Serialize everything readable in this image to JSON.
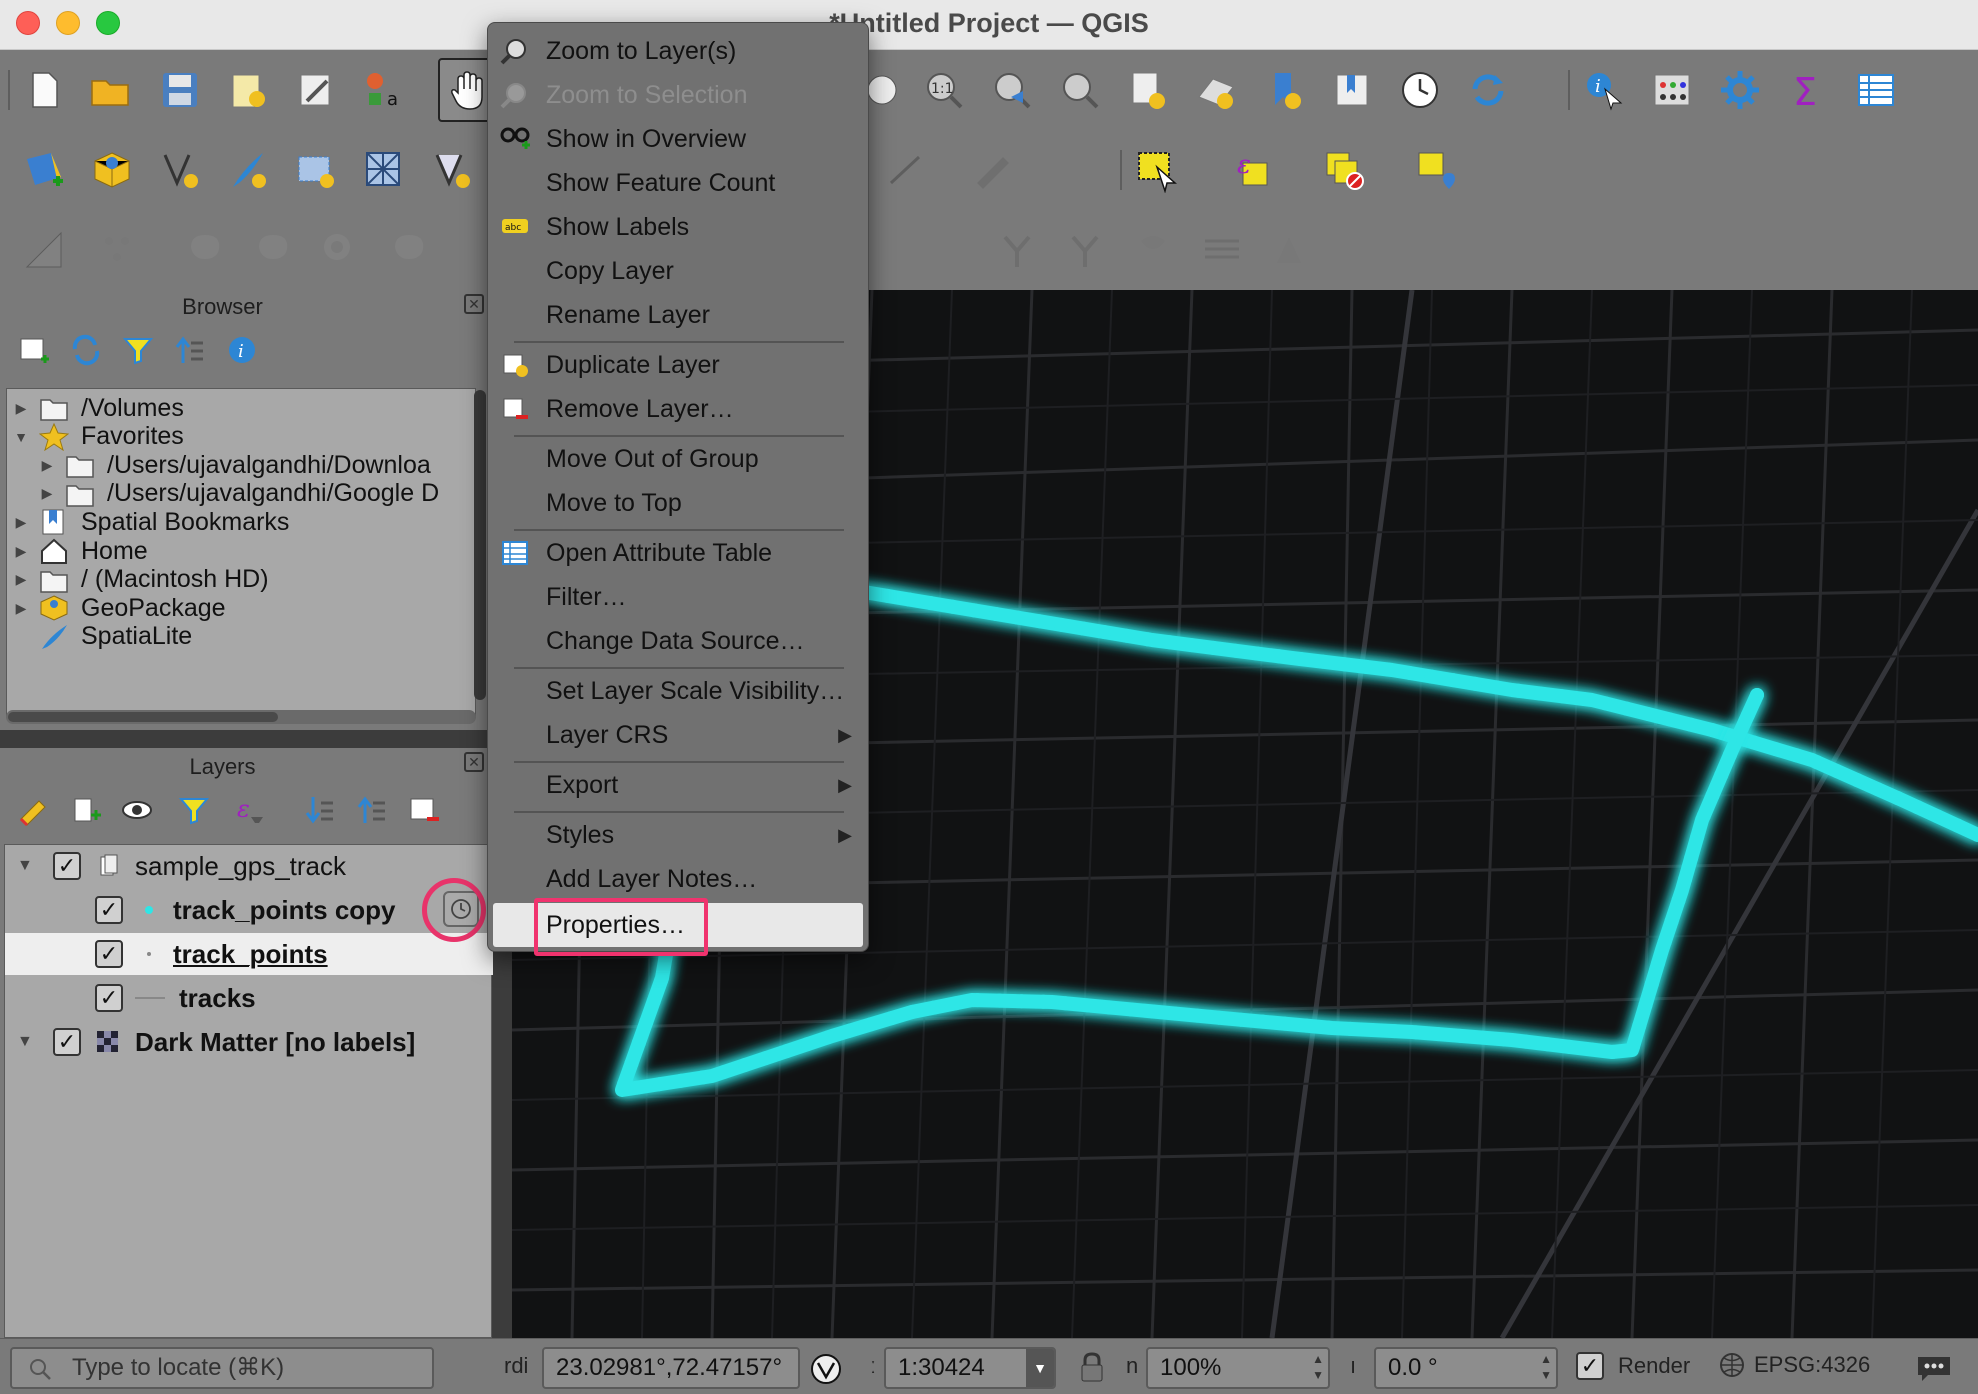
{
  "window": {
    "title": "*Untitled Project — QGIS"
  },
  "browser": {
    "title": "Browser",
    "items": [
      {
        "label": "/Volumes",
        "indent": 0,
        "arrow": "▶"
      },
      {
        "label": "Favorites",
        "indent": 0,
        "arrow": "▼"
      },
      {
        "label": "/Users/ujavalgandhi/Downloa",
        "indent": 1,
        "arrow": "▶"
      },
      {
        "label": "/Users/ujavalgandhi/Google D",
        "indent": 1,
        "arrow": "▶"
      },
      {
        "label": "Spatial Bookmarks",
        "indent": 0,
        "arrow": "▶"
      },
      {
        "label": "Home",
        "indent": 0,
        "arrow": "▶"
      },
      {
        "label": "/ (Macintosh HD)",
        "indent": 0,
        "arrow": "▶"
      },
      {
        "label": "GeoPackage",
        "indent": 0,
        "arrow": "▶"
      },
      {
        "label": "SpatiaLite",
        "indent": 0,
        "arrow": ""
      }
    ]
  },
  "layers": {
    "title": "Layers",
    "items": [
      {
        "label": "sample_gps_track",
        "checked": "✓",
        "arrow": "▼"
      },
      {
        "label": "track_points copy",
        "checked": "✓"
      },
      {
        "label": "track_points",
        "checked": "✓"
      },
      {
        "label": "tracks",
        "checked": "✓"
      },
      {
        "label": "Dark Matter [no labels]",
        "checked": "✓",
        "arrow": "▼"
      }
    ]
  },
  "context_menu": {
    "items": [
      {
        "label": "Zoom to Layer(s)",
        "icon": "zoom-layer-icon"
      },
      {
        "label": "Zoom to Selection",
        "icon": "zoom-selection-icon",
        "disabled": true
      },
      {
        "label": "Show in Overview",
        "icon": "overview-icon"
      },
      {
        "label": "Show Feature Count"
      },
      {
        "label": "Show Labels",
        "icon": "labels-icon"
      },
      {
        "label": "Copy Layer"
      },
      {
        "label": "Rename Layer"
      },
      {
        "label": "Duplicate Layer",
        "icon": "duplicate-layer-icon"
      },
      {
        "label": "Remove Layer…",
        "icon": "remove-layer-icon"
      },
      {
        "label": "Move Out of Group"
      },
      {
        "label": "Move to Top"
      },
      {
        "label": "Open Attribute Table",
        "icon": "attribute-table-icon"
      },
      {
        "label": "Filter…"
      },
      {
        "label": "Change Data Source…"
      },
      {
        "label": "Set Layer Scale Visibility…"
      },
      {
        "label": "Layer CRS",
        "submenu": true
      },
      {
        "label": "Export",
        "submenu": true
      },
      {
        "label": "Styles",
        "submenu": true
      },
      {
        "label": "Add Layer Notes…"
      },
      {
        "label": "Properties…",
        "highlighted": true
      }
    ],
    "submenu_arrow": "▶"
  },
  "statusbar": {
    "locator_placeholder": "Type to locate (⌘K)",
    "coordinate_label": "rdi",
    "coordinate": "23.02981°,72.47157°",
    "scale_label": "ː",
    "scale": "1:30424",
    "magnifier_label": "n",
    "magnifier": "100%",
    "rotation_label": "ı",
    "rotation": "0.0 °",
    "render_label": "Render",
    "render_checked": "✓",
    "crs": "EPSG:4326"
  },
  "colors": {
    "track": "#2ee6e6",
    "highlight": "#f0336e",
    "map_bg": "#111213"
  }
}
